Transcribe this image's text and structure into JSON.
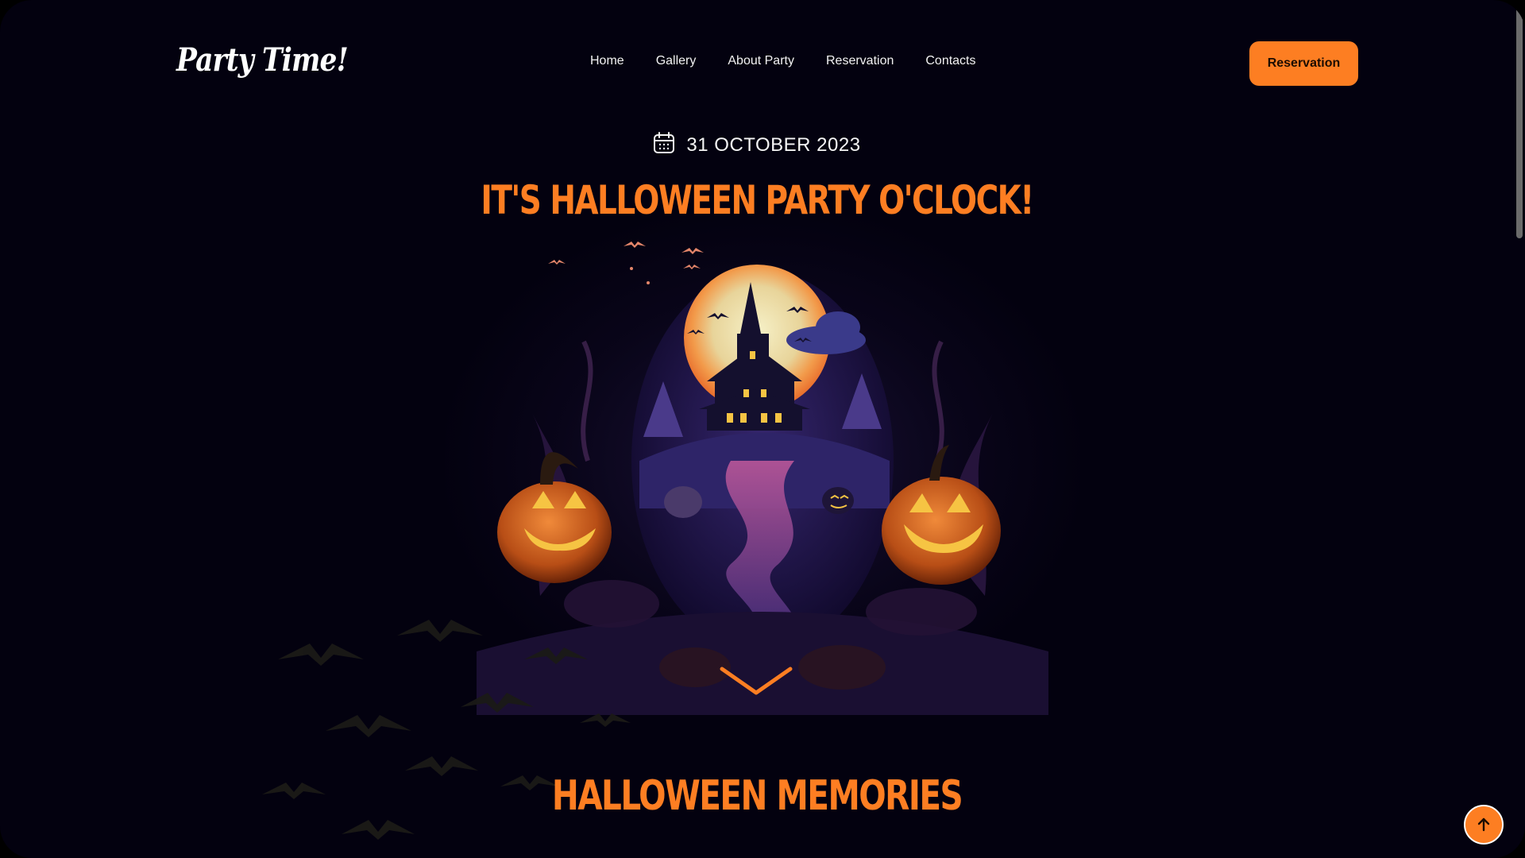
{
  "logo": {
    "text": "Party Time!"
  },
  "nav": {
    "items": [
      {
        "label": "Home"
      },
      {
        "label": "Gallery"
      },
      {
        "label": "About Party"
      },
      {
        "label": "Reservation"
      },
      {
        "label": "Contacts"
      }
    ]
  },
  "header": {
    "cta_label": "Reservation"
  },
  "hero": {
    "date": "31 OCTOBER 2023",
    "title": "IT'S HALLOWEEN PARTY O'CLOCK!"
  },
  "sections": {
    "memories_title": "HALLOWEEN MEMORIES"
  },
  "icons": {
    "calendar": "calendar-icon",
    "chevron": "chevron-down-icon",
    "arrow_up": "arrow-up-icon"
  },
  "colors": {
    "accent": "#fd7e22",
    "background": "#03010f",
    "text": "#f2f2f2"
  }
}
